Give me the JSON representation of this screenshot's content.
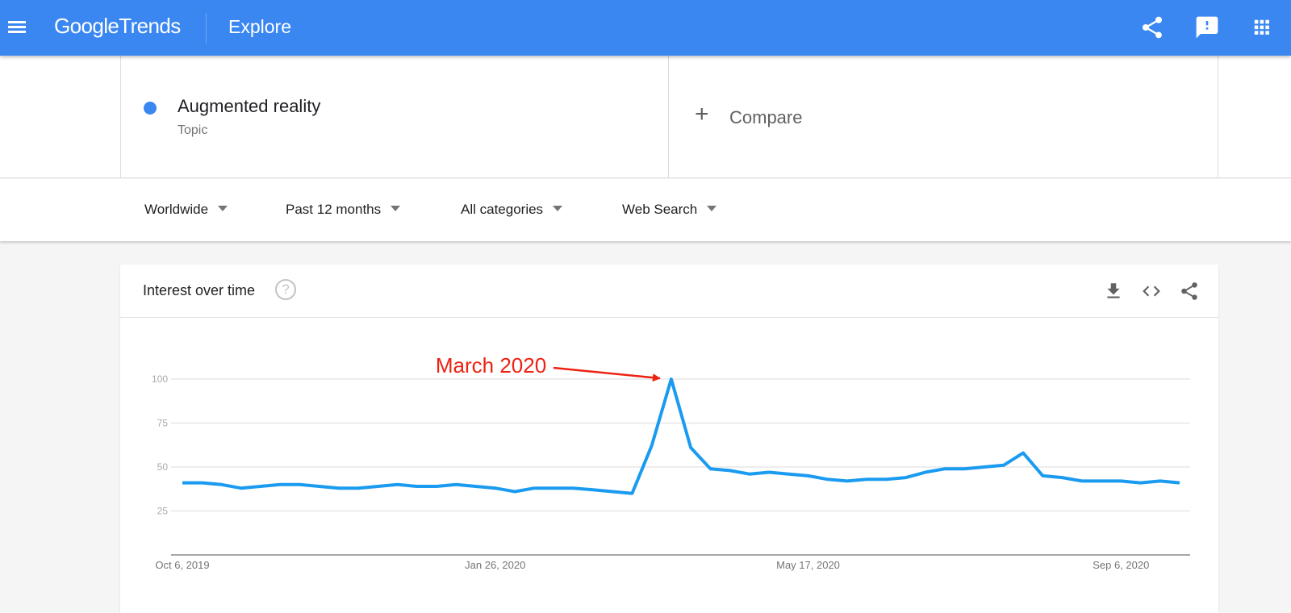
{
  "header": {
    "app_name_bold": "Google",
    "app_name_light": "Trends",
    "page": "Explore",
    "icons": [
      "menu-icon",
      "share-icon",
      "feedback-icon",
      "apps-grid-icon"
    ]
  },
  "search_terms": [
    {
      "name": "Augmented reality",
      "type": "Topic",
      "color": "#3a87f2"
    }
  ],
  "compare": {
    "label": "Compare",
    "icon": "plus-icon"
  },
  "filters": [
    {
      "label": "Worldwide"
    },
    {
      "label": "Past 12 months"
    },
    {
      "label": "All categories"
    },
    {
      "label": "Web Search"
    }
  ],
  "card": {
    "title": "Interest over time",
    "help_symbol": "?",
    "actions": [
      "download-icon",
      "embed-code-icon",
      "share-icon"
    ]
  },
  "chart_data": {
    "type": "line",
    "title": "Interest over time",
    "xlabel": "",
    "ylabel": "",
    "ylim": [
      0,
      100
    ],
    "yticks": [
      25,
      50,
      75,
      100
    ],
    "grid": true,
    "line_color": "#1a9bf0",
    "x_tick_labels": [
      {
        "label": "Oct 6, 2019",
        "index": 0
      },
      {
        "label": "Jan 26, 2020",
        "index": 16
      },
      {
        "label": "May 17, 2020",
        "index": 32
      },
      {
        "label": "Sep 6, 2020",
        "index": 48
      }
    ],
    "series": [
      {
        "name": "Augmented reality",
        "values": [
          41,
          41,
          40,
          38,
          39,
          40,
          40,
          39,
          38,
          38,
          39,
          40,
          39,
          39,
          40,
          39,
          38,
          36,
          38,
          38,
          38,
          37,
          36,
          35,
          62,
          100,
          61,
          49,
          48,
          46,
          47,
          46,
          45,
          43,
          42,
          43,
          43,
          44,
          47,
          49,
          49,
          50,
          51,
          58,
          45,
          44,
          42,
          42,
          42,
          41,
          42,
          41
        ]
      }
    ],
    "annotations": [
      {
        "text": "March 2020",
        "points_to_index": 25,
        "color": "#ee2211"
      }
    ]
  }
}
